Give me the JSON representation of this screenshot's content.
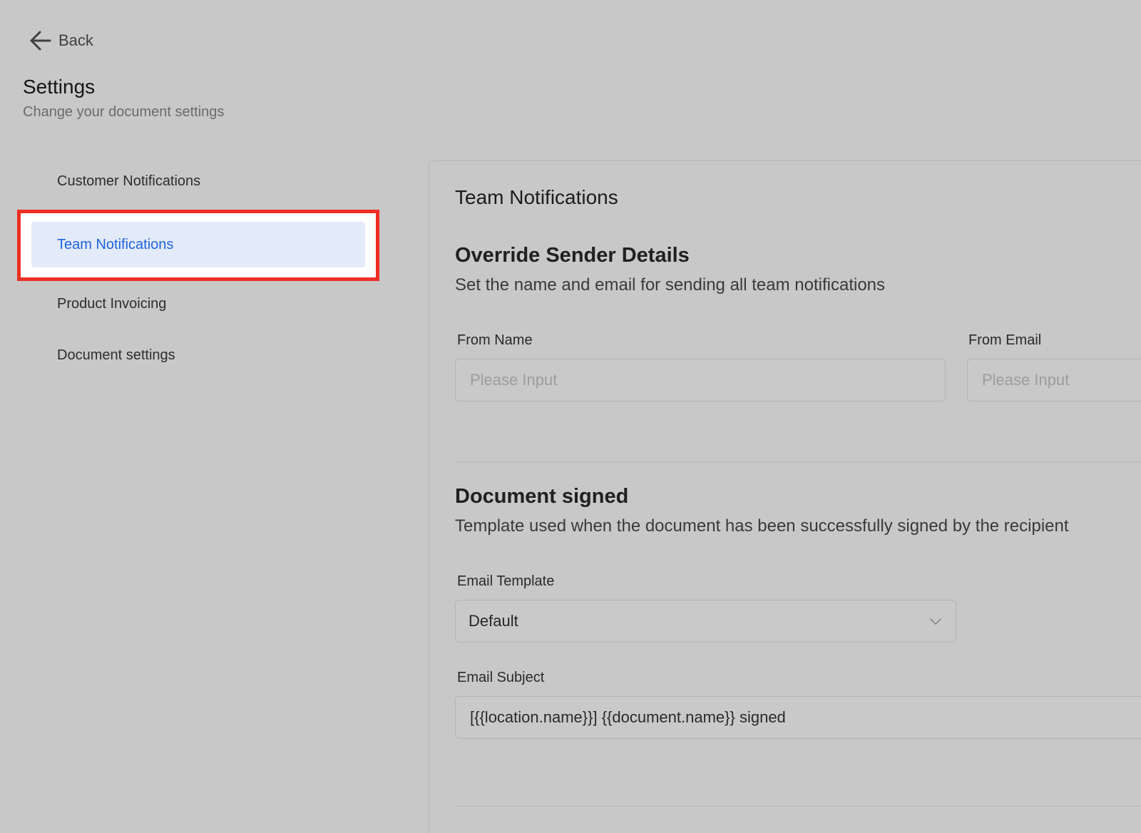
{
  "header": {
    "back_label": "Back",
    "title": "Settings",
    "subtitle": "Change your document settings"
  },
  "nav": {
    "items": [
      {
        "label": "Customer Notifications"
      },
      {
        "label": "Team Notifications"
      },
      {
        "label": "Product Invoicing"
      },
      {
        "label": "Document settings"
      }
    ],
    "active_index": 1
  },
  "panel": {
    "title": "Team Notifications",
    "sender": {
      "title": "Override Sender Details",
      "description": "Set the name and email for sending all team notifications",
      "from_name_label": "From Name",
      "from_name_placeholder": "Please Input",
      "from_email_label": "From Email",
      "from_email_placeholder": "Please Input"
    },
    "signed": {
      "title": "Document signed",
      "description": "Template used when the document has been successfully signed by the recipient",
      "template_label": "Email Template",
      "template_value": "Default",
      "subject_label": "Email Subject",
      "subject_value": "[{{location.name}}] {{document.name}} signed"
    }
  },
  "colors": {
    "highlight_border": "#ee2e24",
    "active_bg": "#e3eaf9",
    "active_text": "#1e63dc"
  }
}
